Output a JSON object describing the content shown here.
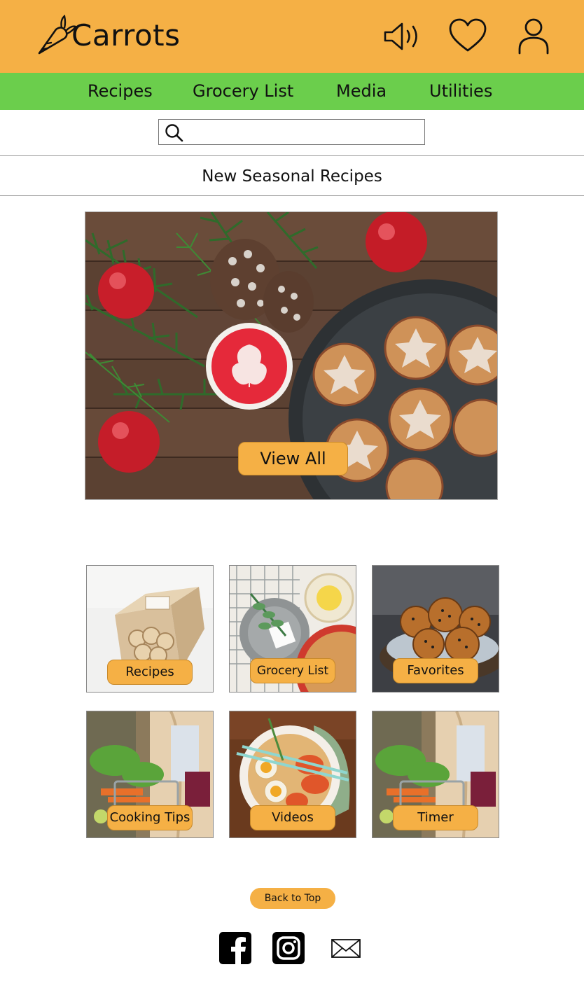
{
  "app": {
    "name": "Carrots",
    "brand_color": "#f5b045",
    "nav_color": "#6bce4c"
  },
  "header": {
    "icons": [
      "speaker-icon",
      "heart-icon",
      "user-icon"
    ]
  },
  "nav": {
    "items": [
      {
        "label": "Recipes"
      },
      {
        "label": "Grocery List"
      },
      {
        "label": "Media"
      },
      {
        "label": "Utilities"
      }
    ]
  },
  "search": {
    "value": "",
    "placeholder": ""
  },
  "section": {
    "title": "New Seasonal Recipes"
  },
  "hero": {
    "button_label": "View All"
  },
  "tiles": [
    {
      "label": "Recipes"
    },
    {
      "label": "Grocery List"
    },
    {
      "label": "Favorites"
    },
    {
      "label": "Cooking Tips"
    },
    {
      "label": "Videos"
    },
    {
      "label": "Timer"
    }
  ],
  "footer": {
    "back_to_top": "Back to Top",
    "social": [
      "facebook-icon",
      "instagram-icon",
      "mail-icon"
    ]
  }
}
